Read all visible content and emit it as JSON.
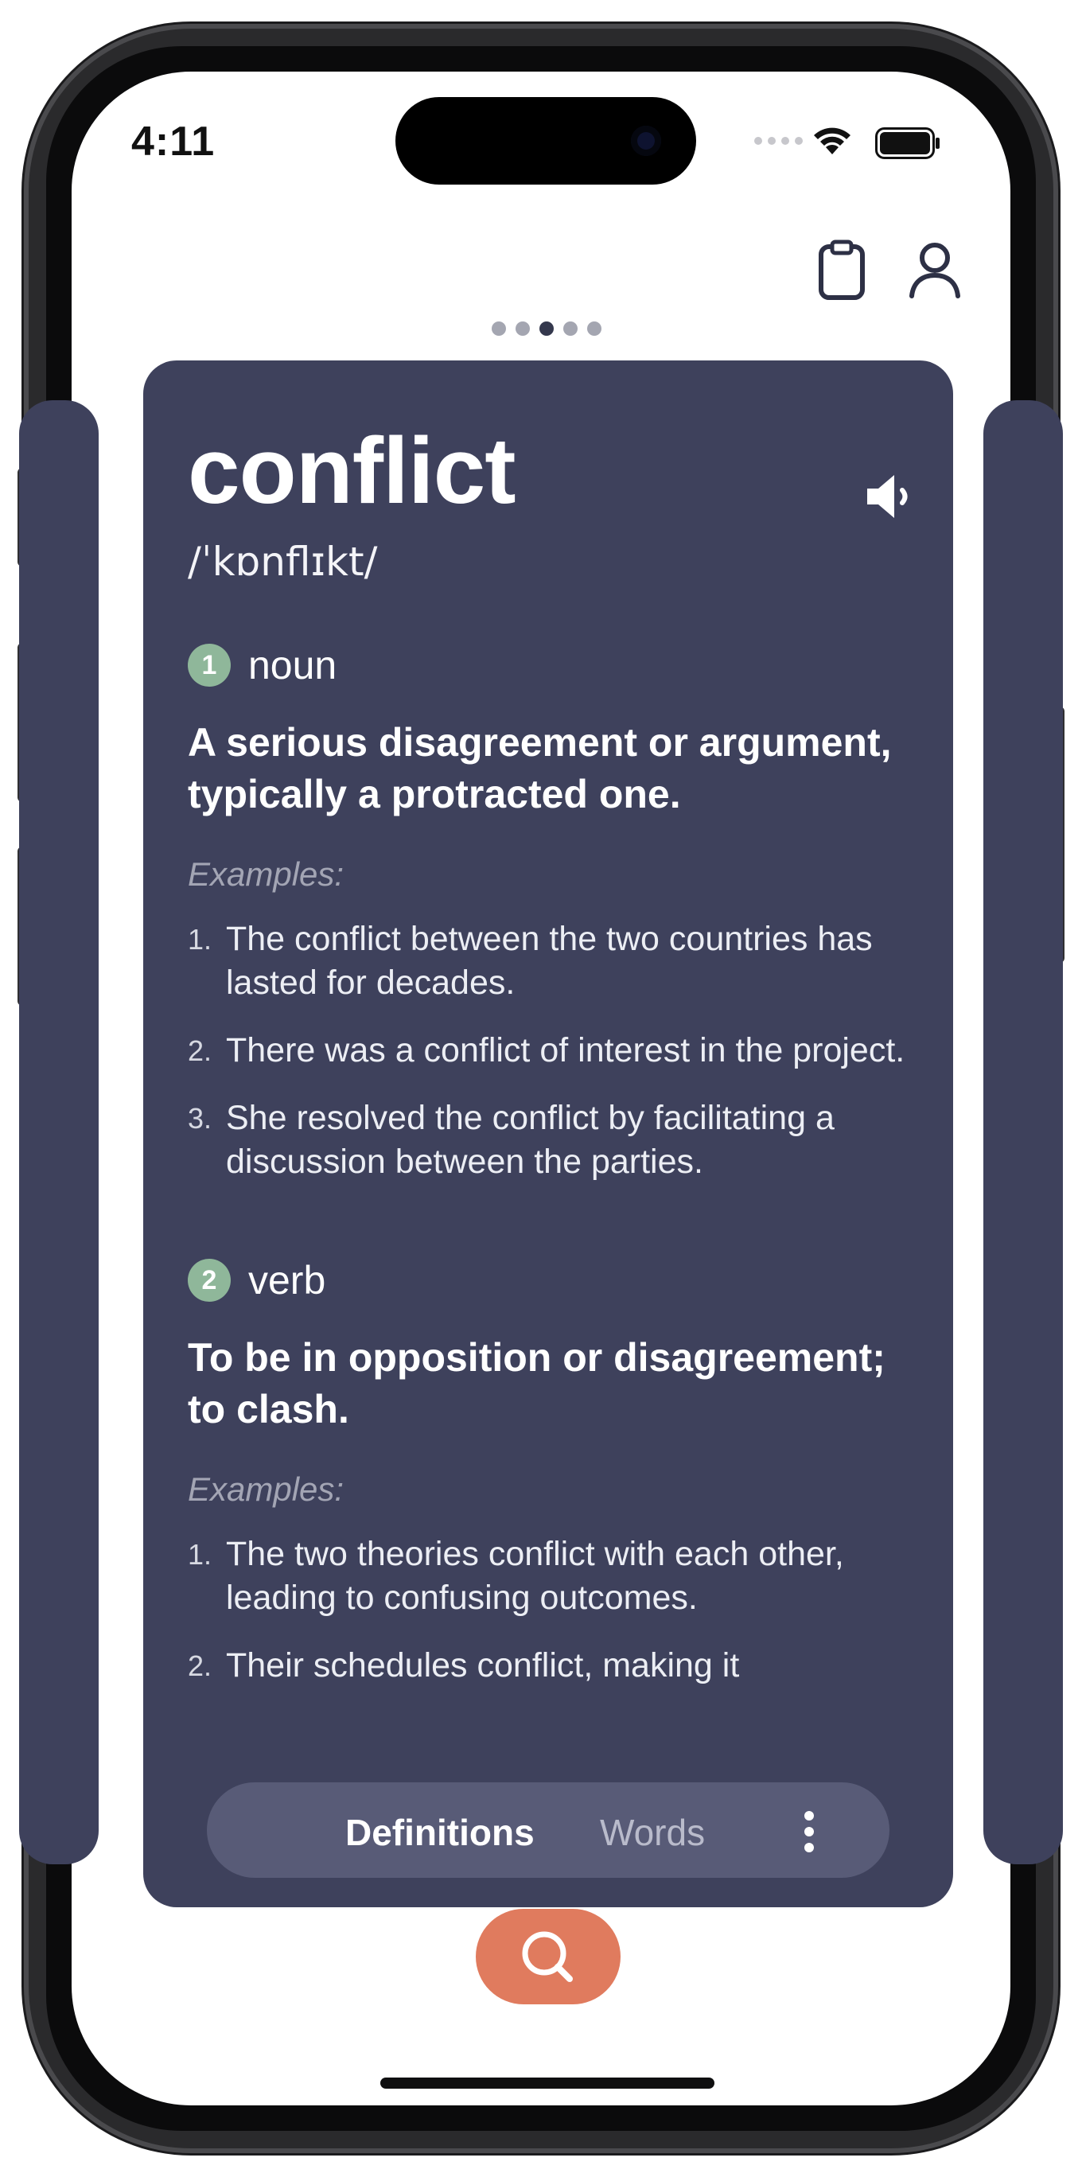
{
  "status_bar": {
    "time": "4:11"
  },
  "header": {
    "clipboard_icon": "clipboard-icon",
    "profile_icon": "person-icon",
    "page_dots": {
      "count": 5,
      "active_index": 2
    }
  },
  "card": {
    "word": "conflict",
    "phonetic": "/ˈkɒnflɪkt/",
    "speaker_icon": "speaker-icon",
    "senses": [
      {
        "number": "1",
        "part_of_speech": "noun",
        "definition": "A serious disagreement or argument, typically a protracted one.",
        "examples_label": "Examples:",
        "examples": [
          {
            "num": "1.",
            "text": "The conflict between the two countries has lasted for decades."
          },
          {
            "num": "2.",
            "text": "There was a conflict of interest in the project."
          },
          {
            "num": "3.",
            "text": "She resolved the conflict by facilitating a discussion between the parties."
          }
        ]
      },
      {
        "number": "2",
        "part_of_speech": "verb",
        "definition": "To be in opposition or disagreement; to clash.",
        "examples_label": "Examples:",
        "examples": [
          {
            "num": "1.",
            "text": "The two theories conflict with each other, leading to confusing outcomes."
          },
          {
            "num": "2.",
            "text": "Their schedules conflict, making it"
          }
        ]
      }
    ]
  },
  "tabs": {
    "definitions": "Definitions",
    "words": "Words",
    "active": "Definitions",
    "more_icon": "more-vertical-icon"
  },
  "search_button_icon": "search-icon",
  "colors": {
    "card_bg": "#3e415c",
    "badge": "#8fb79a",
    "search_button": "#e07b5e",
    "tab_bar": "#585b77"
  }
}
